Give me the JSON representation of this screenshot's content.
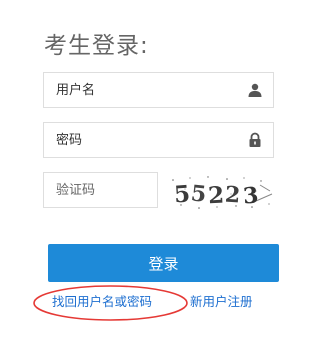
{
  "page": {
    "title": "考生登录:"
  },
  "form": {
    "username": {
      "placeholder": "用户名",
      "icon": "user-icon"
    },
    "password": {
      "placeholder": "密码",
      "icon": "lock-icon"
    },
    "captcha": {
      "placeholder": "验证码",
      "image_text": "55223"
    },
    "login_label": "登录",
    "colors": {
      "button": "#1e8ad8",
      "link": "#1e6fd0",
      "highlight": "#e53935"
    }
  },
  "links": {
    "forgot": "找回用户名或密码",
    "register": "新用户注册"
  }
}
